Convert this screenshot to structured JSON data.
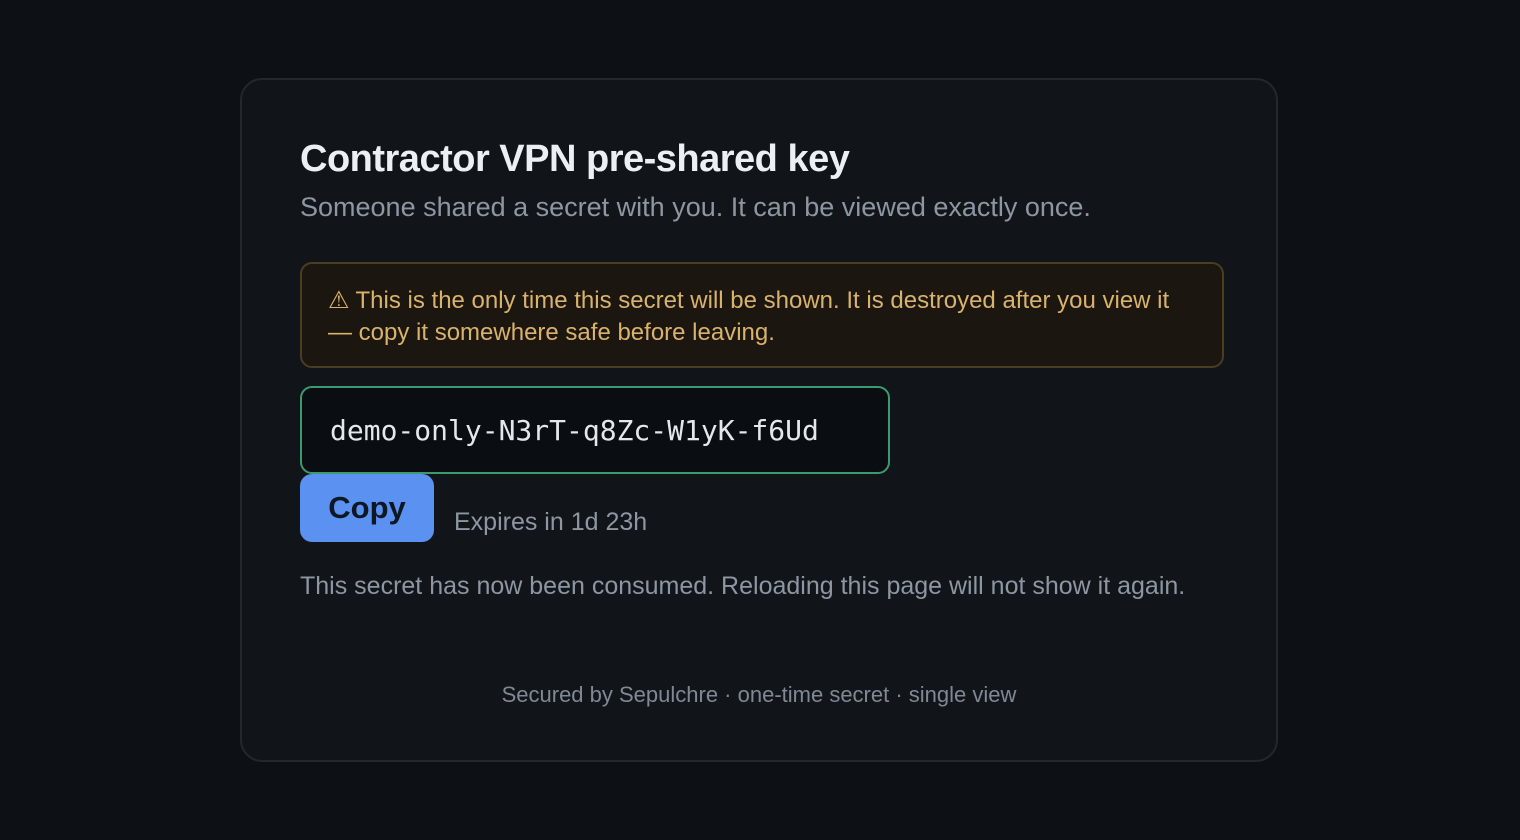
{
  "page": {
    "title": "Contractor VPN pre-shared key",
    "subtitle": "Someone shared a secret with you. It can be viewed exactly once."
  },
  "warning": {
    "icon": "warning-triangle-icon",
    "icon_glyph": "⚠",
    "text": "This is the only time this secret will be shown. It is destroyed after you view it — copy it somewhere safe before leaving.",
    "color": "#d9b26c"
  },
  "secret": {
    "value": "demo-only-N3rT-q8Zc-W1yK-f6Ud",
    "border_color": "#3e9a6e"
  },
  "actions": {
    "copy_label": "Copy",
    "accent_color": "#5b91f0"
  },
  "expiry": {
    "text": "Expires in 1d 23h"
  },
  "status": {
    "consumed_text": "This secret has now been consumed. Reloading this page will not show it again."
  },
  "footer": {
    "text": "Secured by Sepulchre · one-time secret · single view"
  }
}
